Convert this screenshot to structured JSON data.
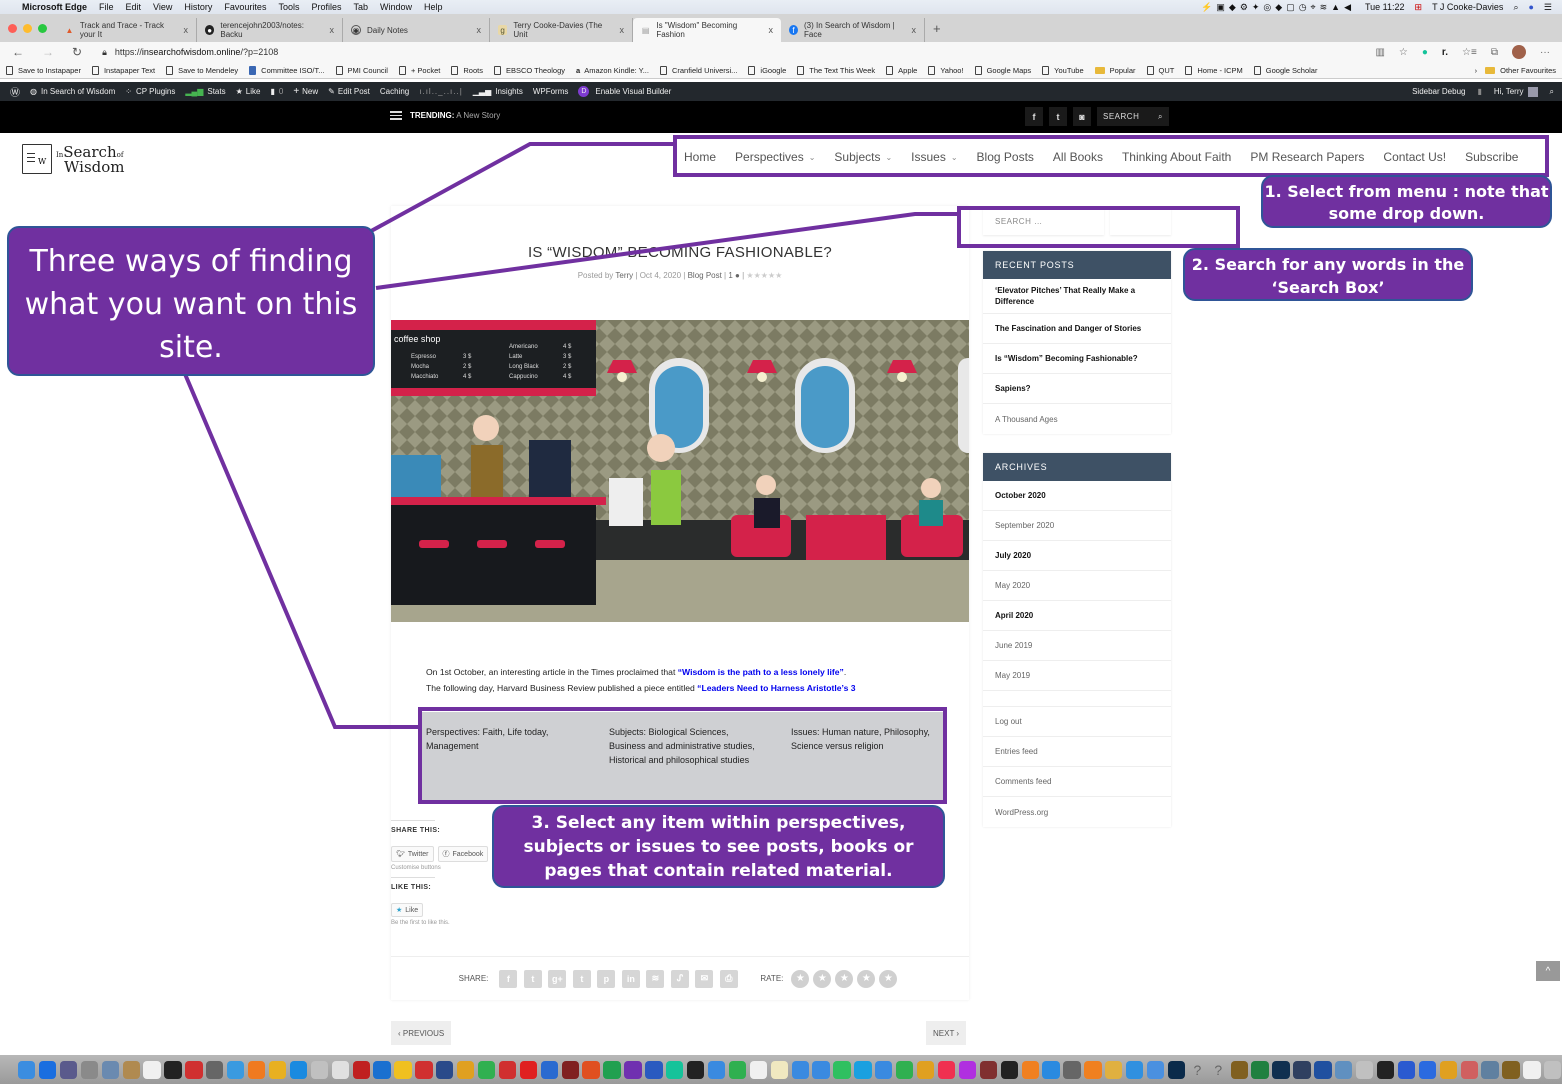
{
  "os_menubar": {
    "app_name": "Microsoft Edge",
    "menus": [
      "File",
      "Edit",
      "View",
      "History",
      "Favourites",
      "Tools",
      "Profiles",
      "Tab",
      "Window",
      "Help"
    ],
    "clock": "Tue 11:22",
    "user": "T J Cooke-Davies"
  },
  "browser": {
    "tabs": [
      {
        "title": "Track and Trace - Track your It",
        "icon": "package-icon",
        "active": false
      },
      {
        "title": "terencejohn2003/notes: Backu",
        "icon": "github-icon",
        "active": false
      },
      {
        "title": "Daily Notes",
        "icon": "notes-icon",
        "active": false
      },
      {
        "title": "Terry Cooke-Davies (The Unit",
        "icon": "goodreads-icon",
        "active": false
      },
      {
        "title": "Is \"Wisdom\" Becoming Fashion",
        "icon": "page-icon",
        "active": true
      },
      {
        "title": "(3) In Search of Wisdom | Face",
        "icon": "facebook-icon",
        "active": false
      }
    ],
    "new_tab": "+",
    "close_tab": "x",
    "url_prefix": "https://",
    "url_domain": "insearchofwisdom.online",
    "url_path": "/?p=2108",
    "bookmarks": [
      {
        "label": "Save to Instapaper",
        "type": "page"
      },
      {
        "label": "Instapaper Text",
        "type": "page"
      },
      {
        "label": "Save to Mendeley",
        "type": "page"
      },
      {
        "label": "Committee ISO/T...",
        "type": "iso"
      },
      {
        "label": "PMI Council",
        "type": "page"
      },
      {
        "label": "+ Pocket",
        "type": "page"
      },
      {
        "label": "Roots",
        "type": "page"
      },
      {
        "label": "EBSCO Theology",
        "type": "page"
      },
      {
        "label": "Amazon Kindle: Y...",
        "type": "amazon"
      },
      {
        "label": "Cranfield Universi...",
        "type": "page"
      },
      {
        "label": "iGoogle",
        "type": "page"
      },
      {
        "label": "The Text This Week",
        "type": "page"
      },
      {
        "label": "Apple",
        "type": "page"
      },
      {
        "label": "Yahoo!",
        "type": "page"
      },
      {
        "label": "Google Maps",
        "type": "page"
      },
      {
        "label": "YouTube",
        "type": "page"
      },
      {
        "label": "Popular",
        "type": "folder"
      },
      {
        "label": "QUT",
        "type": "page"
      },
      {
        "label": "Home - ICPM",
        "type": "page"
      },
      {
        "label": "Google Scholar",
        "type": "page"
      }
    ],
    "other_favourites": "Other Favourites"
  },
  "wp_admin_bar": {
    "site_name": "In Search of Wisdom",
    "items": [
      "CP Plugins",
      "Stats",
      "Like",
      "0",
      "New",
      "Edit Post",
      "Caching",
      "Insights",
      "WPForms",
      "Enable Visual Builder"
    ],
    "right": {
      "debug": "Sidebar Debug",
      "greeting": "Hi, Terry"
    }
  },
  "site_header": {
    "trending_label": "TRENDING:",
    "trending_story": "A New Story",
    "search_label": "SEARCH",
    "logo": {
      "in": "In",
      "search": "Search",
      "of": "of",
      "wisdom": "Wisdom"
    }
  },
  "main_nav": [
    {
      "label": "Home",
      "dropdown": false
    },
    {
      "label": "Perspectives",
      "dropdown": true
    },
    {
      "label": "Subjects",
      "dropdown": true
    },
    {
      "label": "Issues",
      "dropdown": true
    },
    {
      "label": "Blog Posts",
      "dropdown": false
    },
    {
      "label": "All Books",
      "dropdown": false
    },
    {
      "label": "Thinking About Faith",
      "dropdown": false
    },
    {
      "label": "PM Research Papers",
      "dropdown": false
    },
    {
      "label": "Contact Us!",
      "dropdown": false
    },
    {
      "label": "Subscribe",
      "dropdown": false
    }
  ],
  "post": {
    "title": "IS “WISDOM” BECOMING FASHIONABLE?",
    "meta": {
      "posted_by": "Posted by",
      "author": "Terry",
      "date": "Oct 4, 2020",
      "category": "Blog Post",
      "comments": "1"
    },
    "image_text": {
      "sign": "coffee shop",
      "menu_left": [
        [
          "Espresso",
          "3 $"
        ],
        [
          "Mocha",
          "2 $"
        ],
        [
          "Macchiato",
          "4 $"
        ]
      ],
      "menu_right": [
        [
          "Americano",
          "4 $"
        ],
        [
          "Latte",
          "3 $"
        ],
        [
          "Long Black",
          "2 $"
        ],
        [
          "Cappucino",
          "4 $"
        ]
      ]
    },
    "body": {
      "line1_pre": "On 1st October, an interesting article in the Times proclaimed that ",
      "line1_link": "“Wisdom is the path to a less lonely life”",
      "line1_post": ".",
      "line2_pre": "The following day, Harvard Business Review published a piece entitled ",
      "line2_link": "“Leaders Need to Harness Aristotle’s 3"
    },
    "taxonomy": {
      "perspectives": "Perspectives: Faith, Life today, Management",
      "subjects": "Subjects: Biological Sciences, Business and administrative studies, Historical and philosophical studies",
      "issues": "Issues: Human nature, Philosophy, Science versus religion"
    },
    "share_this": "SHARE THIS:",
    "share_buttons": [
      "Twitter",
      "Facebook"
    ],
    "customise": "Customise buttons",
    "like_this": "LIKE THIS:",
    "like_button": "Like",
    "like_note": "Be the first to like this.",
    "share_label": "SHARE:",
    "share_icons": [
      "facebook",
      "twitter",
      "google-plus",
      "tumblr",
      "pinterest",
      "linkedin",
      "buffer",
      "stumbleupon",
      "email",
      "print"
    ],
    "rate_label": "RATE:",
    "rating": {
      "value": 0,
      "max": 5
    },
    "previous": "‹ PREVIOUS",
    "next": "NEXT ›"
  },
  "sidebar": {
    "search_placeholder": "SEARCH …",
    "recent_posts": {
      "title": "RECENT POSTS",
      "items": [
        {
          "label": "‘Elevator Pitches’ That Really Make a Difference",
          "bold": true
        },
        {
          "label": "The Fascination and Danger of Stories",
          "bold": true
        },
        {
          "label": "Is “Wisdom” Becoming Fashionable?",
          "bold": true
        },
        {
          "label": "Sapiens?",
          "bold": true
        },
        {
          "label": "A Thousand Ages",
          "bold": false
        }
      ]
    },
    "archives": {
      "title": "ARCHIVES",
      "items": [
        {
          "label": "October 2020",
          "bold": true
        },
        {
          "label": "September 2020",
          "bold": false
        },
        {
          "label": "July 2020",
          "bold": true
        },
        {
          "label": "May 2020",
          "bold": false
        },
        {
          "label": "April 2020",
          "bold": true
        },
        {
          "label": "June 2019",
          "bold": false
        },
        {
          "label": "May 2019",
          "bold": false
        }
      ]
    },
    "meta": [
      "Log out",
      "Entries feed",
      "Comments feed",
      "WordPress.org"
    ]
  },
  "callouts": {
    "main": "Three ways of finding what you want on this site.",
    "step1": "1. Select from menu : note that some drop down.",
    "step2": "2.  Search for any words in the ‘Search Box’",
    "step3": "3.  Select any item within perspectives, subjects or issues to see posts, books or pages  that contain related material."
  },
  "colors": {
    "callout_fill": "#7030a0",
    "callout_border": "#2f5597",
    "widget_header": "#3e5165",
    "link_blue": "#0000ee"
  }
}
